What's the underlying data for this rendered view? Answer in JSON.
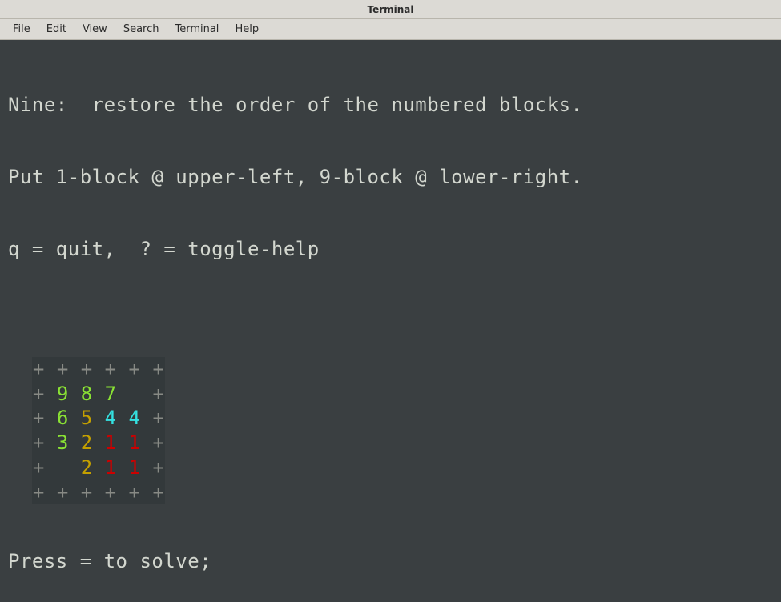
{
  "window": {
    "title": "Terminal"
  },
  "menu": {
    "items": [
      "File",
      "Edit",
      "View",
      "Search",
      "Terminal",
      "Help"
    ]
  },
  "help": {
    "line1": "Nine:  restore the order of the numbered blocks.",
    "line2": "Put 1-block @ upper-left, 9-block @ lower-right.",
    "line3": "q = quit,  ? = toggle-help"
  },
  "grid": {
    "border_char": "+",
    "rows": [
      [
        {
          "t": "+",
          "c": "border"
        },
        {
          "t": " "
        },
        {
          "t": "+",
          "c": "border"
        },
        {
          "t": " "
        },
        {
          "t": "+",
          "c": "border"
        },
        {
          "t": " "
        },
        {
          "t": "+",
          "c": "border"
        },
        {
          "t": " "
        },
        {
          "t": "+",
          "c": "border"
        },
        {
          "t": " "
        },
        {
          "t": "+",
          "c": "border"
        }
      ],
      [
        {
          "t": "+",
          "c": "border"
        },
        {
          "t": " "
        },
        {
          "t": "9",
          "c": "c-green"
        },
        {
          "t": " "
        },
        {
          "t": "8",
          "c": "c-green"
        },
        {
          "t": " "
        },
        {
          "t": "7",
          "c": "c-green"
        },
        {
          "t": " "
        },
        {
          "t": " "
        },
        {
          "t": " "
        },
        {
          "t": "+",
          "c": "border"
        }
      ],
      [
        {
          "t": "+",
          "c": "border"
        },
        {
          "t": " "
        },
        {
          "t": "6",
          "c": "c-green"
        },
        {
          "t": " "
        },
        {
          "t": "5",
          "c": "c-yellow"
        },
        {
          "t": " "
        },
        {
          "t": "4",
          "c": "c-teal"
        },
        {
          "t": " "
        },
        {
          "t": "4",
          "c": "c-teal"
        },
        {
          "t": " "
        },
        {
          "t": "+",
          "c": "border"
        }
      ],
      [
        {
          "t": "+",
          "c": "border"
        },
        {
          "t": " "
        },
        {
          "t": "3",
          "c": "c-green"
        },
        {
          "t": " "
        },
        {
          "t": "2",
          "c": "c-yellow"
        },
        {
          "t": " "
        },
        {
          "t": "1",
          "c": "c-red"
        },
        {
          "t": " "
        },
        {
          "t": "1",
          "c": "c-red"
        },
        {
          "t": " "
        },
        {
          "t": "+",
          "c": "border"
        }
      ],
      [
        {
          "t": "+",
          "c": "border"
        },
        {
          "t": " "
        },
        {
          "t": " "
        },
        {
          "t": " "
        },
        {
          "t": "2",
          "c": "c-yellow"
        },
        {
          "t": " "
        },
        {
          "t": "1",
          "c": "c-red"
        },
        {
          "t": " "
        },
        {
          "t": "1",
          "c": "c-red"
        },
        {
          "t": " "
        },
        {
          "t": "+",
          "c": "border"
        }
      ],
      [
        {
          "t": "+",
          "c": "border"
        },
        {
          "t": " "
        },
        {
          "t": "+",
          "c": "border"
        },
        {
          "t": " "
        },
        {
          "t": "+",
          "c": "border"
        },
        {
          "t": " "
        },
        {
          "t": "+",
          "c": "border"
        },
        {
          "t": " "
        },
        {
          "t": "+",
          "c": "border"
        },
        {
          "t": " "
        },
        {
          "t": "+",
          "c": "border"
        }
      ]
    ]
  },
  "prompt": {
    "text": "Press = to solve;"
  }
}
